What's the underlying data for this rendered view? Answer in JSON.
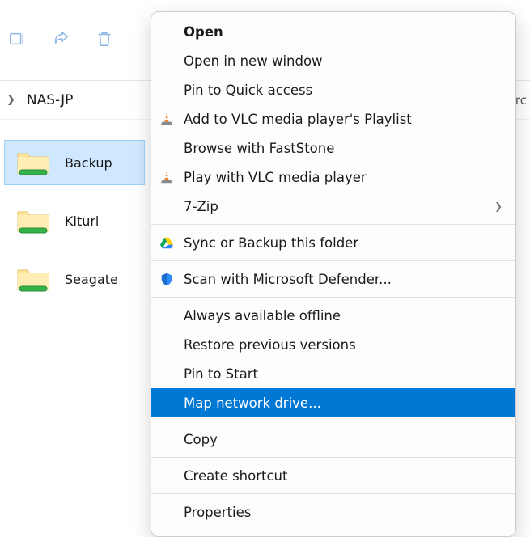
{
  "toolbar": {
    "icons": [
      "rename-icon",
      "share-icon",
      "delete-icon"
    ]
  },
  "breadcrumb": {
    "location": "NAS-JP",
    "right_fragment": "rc"
  },
  "files": {
    "items": [
      {
        "name": "Backup",
        "selected": true
      },
      {
        "name": "Kituri",
        "selected": false
      },
      {
        "name": "Seagate",
        "selected": false
      }
    ]
  },
  "context_menu": {
    "highlighted_index": 15,
    "items": [
      {
        "label": "Open",
        "bold": true
      },
      {
        "label": "Open in new window"
      },
      {
        "label": "Pin to Quick access"
      },
      {
        "label": "Add to VLC media player's Playlist",
        "icon": "vlc-icon"
      },
      {
        "label": "Browse with FastStone"
      },
      {
        "label": "Play with VLC media player",
        "icon": "vlc-icon"
      },
      {
        "label": "7-Zip",
        "submenu": true
      },
      {
        "sep": true
      },
      {
        "label": "Sync or Backup this folder",
        "icon": "google-drive-icon"
      },
      {
        "sep": true
      },
      {
        "label": "Scan with Microsoft Defender...",
        "icon": "defender-shield-icon"
      },
      {
        "sep": true
      },
      {
        "label": "Always available offline"
      },
      {
        "label": "Restore previous versions"
      },
      {
        "label": "Pin to Start"
      },
      {
        "label": "Map network drive..."
      },
      {
        "sep": true
      },
      {
        "label": "Copy"
      },
      {
        "sep": true
      },
      {
        "label": "Create shortcut"
      },
      {
        "sep": true
      },
      {
        "label": "Properties"
      }
    ]
  }
}
